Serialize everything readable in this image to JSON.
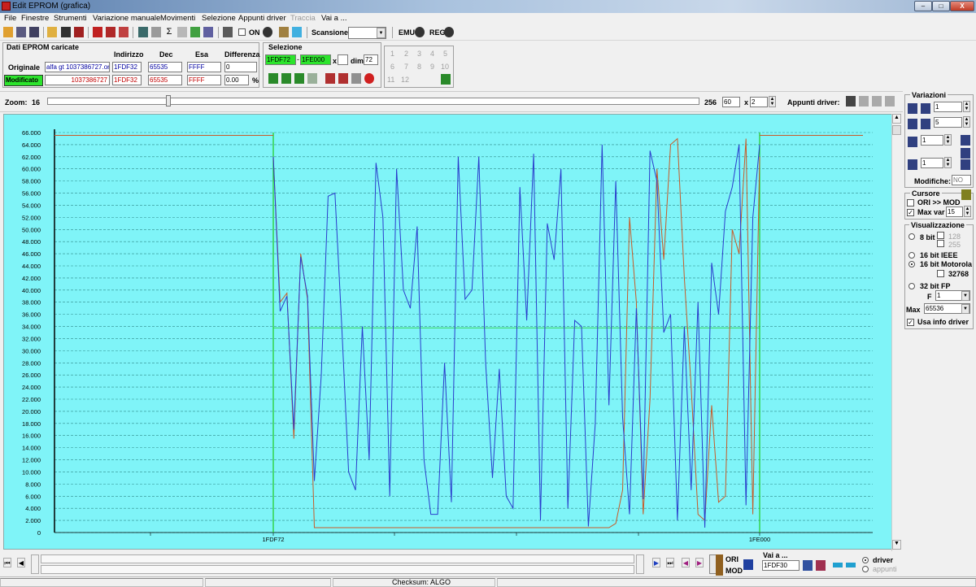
{
  "window": {
    "title": "Edit EPROM (grafica)"
  },
  "menu": [
    "File",
    "Finestre",
    "Strumenti",
    "Variazione manuale",
    "Movimenti",
    "Selezione",
    "Appunti driver",
    "Traccia",
    "Vai a ..."
  ],
  "toolbar": {
    "on_label": "ON",
    "scan_label": "Scansione",
    "scan_value": "",
    "emu_label": "EMU",
    "reg_label": "REG"
  },
  "eprom": {
    "title": "Dati EPROM caricate",
    "headers": {
      "address": "Indirizzo",
      "dec": "Dec",
      "hex": "Esa",
      "diff": "Differenza"
    },
    "original": {
      "label": "Originale",
      "file": "alfa gt 1037386727.ori",
      "address": "1FDF32",
      "dec": "65535",
      "hex": "FFFF",
      "diff": "0"
    },
    "modified": {
      "label": "Modificato",
      "file": "1037386727",
      "address": "1FDF32",
      "dec": "65535",
      "hex": "FFFF",
      "diff": "0.00",
      "diff_unit": "%"
    }
  },
  "selection": {
    "title": "Selezione",
    "from": "1FDF72",
    "to": "1FE000",
    "x_label": "x",
    "dim_label": "dim.",
    "dim": "72",
    "numbers": [
      "1",
      "2",
      "3",
      "4",
      "5",
      "6",
      "7",
      "8",
      "9",
      "10",
      "11",
      "12"
    ]
  },
  "zoom": {
    "label": "Zoom:",
    "value": "16",
    "max": "256",
    "field": "60",
    "x_label": "x",
    "factor": "2",
    "clip_label": "Appunti driver:"
  },
  "variations": {
    "title": "Variazioni",
    "v1": "1",
    "v2": "5",
    "v3": "1",
    "v4": "1",
    "mods_label": "Modifiche:",
    "mods_value": "NO"
  },
  "cursor": {
    "title": "Cursore",
    "ori_mod": "ORI >> MOD",
    "maxvar_label": "Max var",
    "maxvar": "15"
  },
  "view": {
    "title": "Visualizzazione",
    "opt8": "8 bit",
    "opt128": "128",
    "opt255": "255",
    "opt16ieee": "16 bit IEEE",
    "opt16mot": "16 bit Motorola",
    "opt32768": "32768",
    "opt32fp": "32 bit FP",
    "f_label": "F",
    "f_value": "1",
    "max_label": "Max",
    "max_value": "65536",
    "info_driver": "Usa info driver"
  },
  "bottom": {
    "ori": "ORI",
    "mod": "MOD",
    "goto_label": "Vai a ...",
    "goto_value": "1FDF30",
    "driver": "driver",
    "appunti": "appunti"
  },
  "status": {
    "checksum": "Checksum: ALGO"
  },
  "colors": {
    "chart_bg": "#7ff4f8",
    "orig_line": "#c85a28",
    "mod_line": "#2a3ccc",
    "marker": "#22cc22"
  },
  "chart_data": {
    "type": "line",
    "ylim": [
      0,
      66000
    ],
    "yticks": [
      "66.000",
      "64.000",
      "62.000",
      "60.000",
      "58.000",
      "56.000",
      "54.000",
      "52.000",
      "50.000",
      "48.000",
      "46.000",
      "44.000",
      "42.000",
      "40.000",
      "38.000",
      "36.000",
      "34.000",
      "32.000",
      "30.000",
      "28.000",
      "26.000",
      "24.000",
      "22.000",
      "20.000",
      "18.000",
      "16.000",
      "14.000",
      "12.000",
      "10.000",
      "8.000",
      "6.000",
      "4.000",
      "2.000",
      "0"
    ],
    "xticks": [
      "1FDF72",
      "1FE000"
    ],
    "series": [
      {
        "values": [
          62000,
          38000,
          39500,
          15500,
          46000,
          38500,
          800,
          800,
          800,
          800,
          800,
          800,
          800,
          800,
          800,
          800,
          800,
          800,
          800,
          800,
          800,
          800,
          800,
          800,
          800,
          800,
          800,
          800,
          800,
          800,
          800,
          800,
          800,
          800,
          800,
          800,
          800,
          800,
          800,
          800,
          800,
          800,
          800,
          800,
          800,
          800,
          800,
          800,
          800,
          800,
          1500,
          7000,
          52000,
          38000,
          3000,
          22000,
          60000,
          45000,
          64000,
          65000,
          42000,
          24000,
          3000,
          2000,
          21000,
          5000,
          6000,
          50000,
          46000,
          65000,
          3000,
          62000
        ]
      },
      {
        "values": [
          62000,
          36500,
          39000,
          17000,
          45500,
          39000,
          8500,
          26000,
          55500,
          56000,
          34000,
          10000,
          7000,
          34000,
          12000,
          61000,
          52000,
          6000,
          60000,
          40000,
          37000,
          50500,
          12000,
          3000,
          3000,
          28000,
          5000,
          62000,
          38500,
          40000,
          62000,
          28000,
          9000,
          27000,
          6000,
          4000,
          57000,
          35000,
          62500,
          2000,
          51000,
          45000,
          60000,
          4000,
          35000,
          34000,
          1000,
          18000,
          64000,
          21000,
          58000,
          19000,
          3000,
          37000,
          5500,
          63000,
          58000,
          33000,
          36000,
          2000,
          34000,
          7000,
          38000,
          800,
          44500,
          36000,
          53000,
          57000,
          64000,
          4500,
          52000,
          64000
        ]
      }
    ]
  }
}
